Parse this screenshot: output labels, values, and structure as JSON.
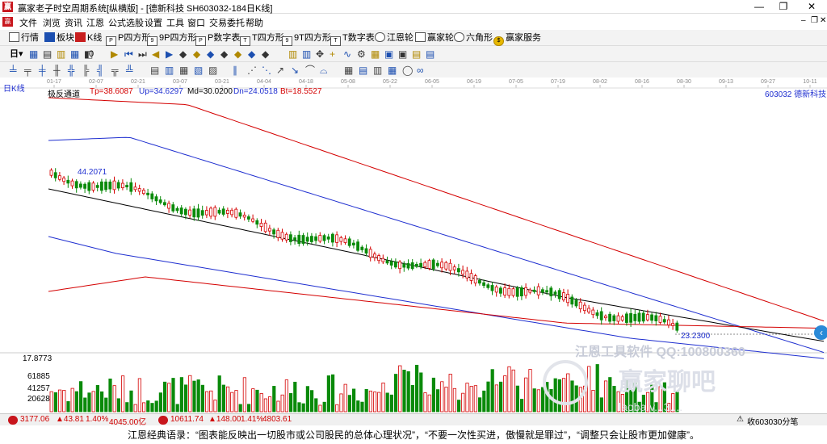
{
  "window": {
    "title": "赢家老子时空周期系统[纵横版] - [德新科技  SH603032-184日K线]",
    "logo": "赢"
  },
  "menu": [
    "文件",
    "浏览",
    "资讯",
    "江恩",
    "公式选股",
    "设置",
    "工具",
    "窗口",
    "交易委托",
    "帮助"
  ],
  "toolbar1": [
    "行情",
    "板块",
    "K线",
    "P四方形",
    "9P四方形",
    "P数字表",
    "T四方形",
    "9T四方形",
    "T数字表",
    "江恩轮",
    "赢家轮",
    "六角形",
    "赢家服务"
  ],
  "toolbar2_labels": {
    "period_value": "0",
    "period_unit": "日"
  },
  "chart": {
    "panel_label": "日K线",
    "header_name": "极反通道",
    "stock_tag": "603032 德新科技",
    "indicators": [
      {
        "label": "Tp=38.6087",
        "color": "#d40000"
      },
      {
        "label": "Up=34.6297",
        "color": "#1f2fd0"
      },
      {
        "label": "Md=30.0200",
        "color": "#000000"
      },
      {
        "label": "Dn=24.0518",
        "color": "#1f2fd0"
      },
      {
        "label": "Bt=18.5527",
        "color": "#d40000"
      }
    ],
    "high_label": "44.2071",
    "low_label": "23.2300",
    "date_ticks": [
      "01-17",
      "02-07",
      "02-21",
      "03-07",
      "03-21",
      "04-04",
      "04-18",
      "05-08",
      "05-22",
      "06-05",
      "06-19",
      "07-05",
      "07-19",
      "08-02",
      "08-16",
      "08-30",
      "09-13",
      "09-27",
      "10-11"
    ],
    "volume_labels": [
      "17.8773",
      "61885",
      "41257",
      "20628"
    ],
    "watermark1": "江恩工具软件  QQ:100800360",
    "watermark2": "赢家聊吧",
    "watermark3": "laoba.v...3....",
    "colors": {
      "up": "#d40000",
      "down": "#0a8a0a",
      "mid": "#000000",
      "band": "#1f2fd0",
      "bg": "#ffffff"
    }
  },
  "chart_data": {
    "type": "candlestick",
    "title": "极反通道",
    "series": [
      {
        "name": "Tp",
        "values": []
      },
      {
        "name": "Up",
        "values": []
      },
      {
        "name": "Md",
        "values": []
      },
      {
        "name": "Dn",
        "values": []
      },
      {
        "name": "Bt",
        "values": []
      }
    ],
    "last_values": {
      "Tp": 38.6087,
      "Up": 34.6297,
      "Md": 30.02,
      "Dn": 24.0518,
      "Bt": 18.5527
    },
    "price_high": 44.2071,
    "price_low": 23.23,
    "x_ticks": [
      "01-17",
      "02-07",
      "02-21",
      "03-07",
      "03-21",
      "04-04",
      "04-18",
      "05-08",
      "05-22",
      "06-05",
      "06-19",
      "07-05",
      "07-19",
      "08-02",
      "08-16",
      "08-30",
      "09-13",
      "09-27",
      "10-11"
    ],
    "volume_axis_labels": [
      61885,
      41257,
      20628
    ]
  },
  "status": {
    "sh_index": "3177.06",
    "sh_change": "▲43.81",
    "sh_pct": "1.40%",
    "sh_amount": "4045.00亿",
    "sz_index": "10611.74",
    "sz_change": "▲148.00",
    "sz_pct": "1.41%",
    "sz_amount": "4803.61",
    "right_text": "收603030分笔"
  },
  "quote": "江恩经典语录：“图表能反映出一切股市或公司股民的总体心理状况”，“不要一次性买进，傲慢就是罪过”，“调整只会让股市更加健康”。"
}
